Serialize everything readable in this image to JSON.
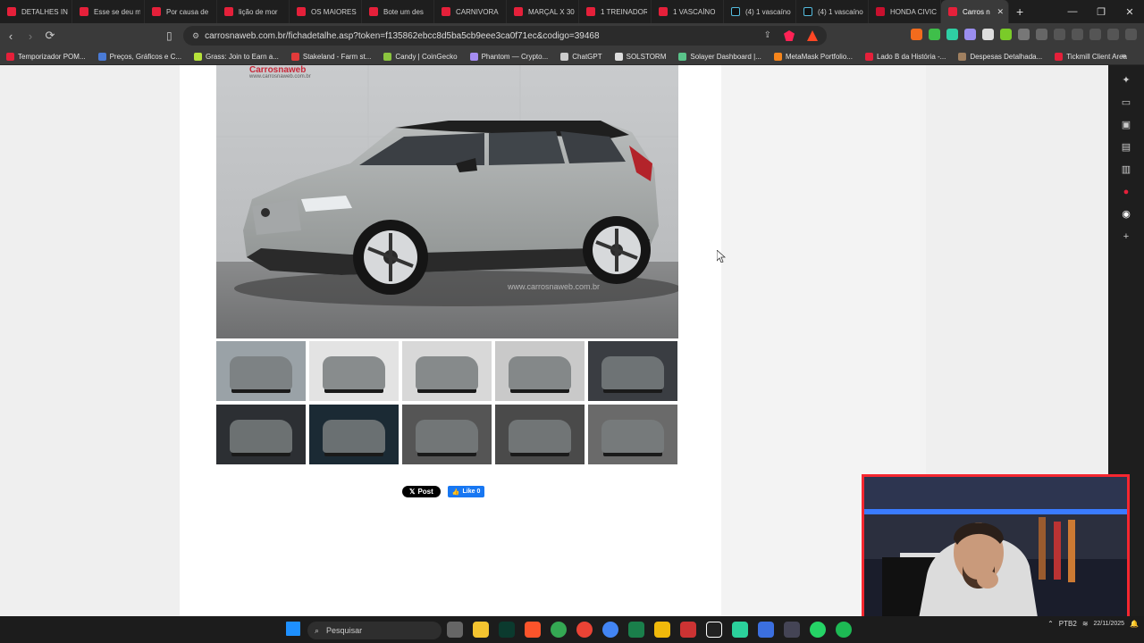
{
  "browser": {
    "tabs": [
      {
        "label": "DETALHES IN",
        "icon": "youtube-icon"
      },
      {
        "label": "Esse se deu m",
        "icon": "youtube-icon"
      },
      {
        "label": "Por causa de",
        "icon": "youtube-icon"
      },
      {
        "label": "lição de mor",
        "icon": "youtube-icon"
      },
      {
        "label": "OS MAIORES",
        "icon": "youtube-icon"
      },
      {
        "label": "Bote um des",
        "icon": "youtube-icon"
      },
      {
        "label": "CARNIVORA",
        "icon": "youtube-icon"
      },
      {
        "label": "MARÇAL X 30",
        "icon": "youtube-icon"
      },
      {
        "label": "1 TREINADOR",
        "icon": "youtube-icon"
      },
      {
        "label": "1 VASCAÍNO",
        "icon": "youtube-icon"
      },
      {
        "label": "(4) 1 vascaíno",
        "icon": "tiktok-icon"
      },
      {
        "label": "(4) 1 vascaíno",
        "icon": "tiktok-icon"
      },
      {
        "label": "HONDA CIVIC",
        "icon": "honda-icon"
      },
      {
        "label": "Carros n",
        "icon": "carrosnaweb-icon",
        "active": true
      }
    ],
    "url": "carrosnaweb.com.br/fichadetalhe.asp?token=f135862ebcc8d5ba5cb9eee3ca0f71ec&codigo=39468",
    "bookmarks": [
      {
        "label": "Temporizador POM...",
        "color": "#e5203a"
      },
      {
        "label": "Preços, Gráficos e C...",
        "color": "#4a7bd6"
      },
      {
        "label": "Grass: Join to Earn a...",
        "color": "#b6e23a"
      },
      {
        "label": "Stakeland - Farm st...",
        "color": "#e23a3a"
      },
      {
        "label": "Candy | CoinGecko",
        "color": "#8bc43f"
      },
      {
        "label": "Phantom — Crypto...",
        "color": "#a58cf2"
      },
      {
        "label": "ChatGPT",
        "color": "#cccccc"
      },
      {
        "label": "SOLSTORM",
        "color": "#dddddd"
      },
      {
        "label": "Solayer Dashboard |...",
        "color": "#5ac48a"
      },
      {
        "label": "MetaMask Portfolio...",
        "color": "#f6851b"
      },
      {
        "label": "Lado B da História -...",
        "color": "#e5203a"
      },
      {
        "label": "Despesas Detalhada...",
        "color": "#a08060"
      },
      {
        "label": "Tickmill Client Area",
        "color": "#e5203a"
      }
    ]
  },
  "page": {
    "watermark_top": "Carrosnaweb",
    "watermark_top_small": "www.carrosnaweb.com.br",
    "watermark_bottom": "www.carrosnaweb.com.br",
    "thumbnails": [
      {
        "name": "thumb-rear-three-quarter",
        "bg": "#9aa2a7"
      },
      {
        "name": "thumb-side-profile",
        "bg": "#e3e3e3"
      },
      {
        "name": "thumb-front",
        "bg": "#d8d8d8"
      },
      {
        "name": "thumb-rear",
        "bg": "#c9c9c9"
      },
      {
        "name": "thumb-trunk",
        "bg": "#3a3d42"
      },
      {
        "name": "thumb-dashboard",
        "bg": "#2c2f33"
      },
      {
        "name": "thumb-instrument-cluster",
        "bg": "#1b2a34"
      },
      {
        "name": "thumb-front-seats",
        "bg": "#555555"
      },
      {
        "name": "thumb-rear-seats",
        "bg": "#4a4a4a"
      },
      {
        "name": "thumb-frunk",
        "bg": "#6a6a6a"
      }
    ],
    "social": {
      "x_post": "Post",
      "fb_like": "Like 0"
    }
  },
  "taskbar": {
    "search_placeholder": "Pesquisar",
    "lang": "PTB2",
    "date": "22/11/2025"
  }
}
